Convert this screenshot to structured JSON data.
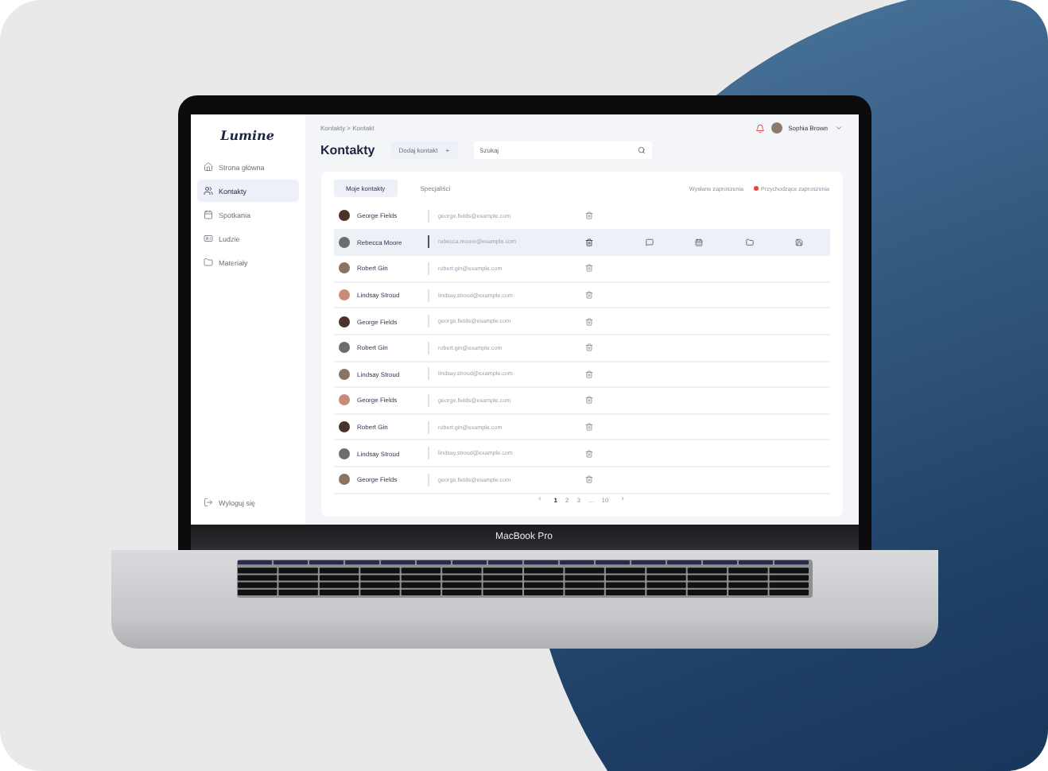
{
  "laptop": {
    "model_label": "MacBook Pro"
  },
  "app": {
    "logo": "Lumine",
    "nav": [
      {
        "kind": "home",
        "label": "Strona główna",
        "selected": false
      },
      {
        "kind": "users",
        "label": "Kontakty",
        "selected": true
      },
      {
        "kind": "calendar",
        "label": "Spotkania",
        "selected": false
      },
      {
        "kind": "card",
        "label": "Ludzie",
        "selected": false
      },
      {
        "kind": "folder",
        "label": "Materiały",
        "selected": false
      }
    ],
    "logout": "Wyloguj się",
    "breadcrumb": "Kontakty > Kontakt",
    "title": "Kontakty",
    "add_button": {
      "label": "Dodaj kontakt",
      "icon": "+"
    },
    "search": {
      "placeholder": "Szukaj"
    },
    "user": {
      "name": "Sophia Brown"
    },
    "tabs": [
      {
        "label": "Moje kontakty",
        "selected": true
      },
      {
        "label": "Specjaliści",
        "selected": false
      }
    ],
    "invites": [
      {
        "label": "Wysłane zaproszenia",
        "unread": false
      },
      {
        "label": "Przychodzące zaproszenia",
        "unread": true
      }
    ],
    "contacts": [
      {
        "name": "George Fields",
        "email": "george.fields@example.com",
        "selected": false
      },
      {
        "name": "Rebecca Moore",
        "email": "rebecca.moore@example.com",
        "selected": true
      },
      {
        "name": "Robert Gin",
        "email": "robert.gin@example.com",
        "selected": false
      },
      {
        "name": "Lindsay Stroud",
        "email": "lindsay.stroud@example.com",
        "selected": false
      },
      {
        "name": "George Fields",
        "email": "george.fields@example.com",
        "selected": false
      },
      {
        "name": "Robert Gin",
        "email": "robert.gin@example.com",
        "selected": false
      },
      {
        "name": "Lindsay Stroud",
        "email": "lindsay.stroud@example.com",
        "selected": false
      },
      {
        "name": "George Fields",
        "email": "george.fields@example.com",
        "selected": false
      },
      {
        "name": "Robert Gin",
        "email": "robert.gin@example.com",
        "selected": false
      },
      {
        "name": "Lindsay Stroud",
        "email": "lindsay.stroud@example.com",
        "selected": false
      },
      {
        "name": "George Fields",
        "email": "george.fields@example.com",
        "selected": false
      }
    ],
    "pagination": {
      "prev": "‹",
      "pages": [
        {
          "label": "1",
          "selected": true
        },
        {
          "label": "2",
          "selected": false
        },
        {
          "label": "3",
          "selected": false
        },
        {
          "label": "...",
          "selected": false
        },
        {
          "label": "10",
          "selected": false
        }
      ],
      "next": "›"
    }
  }
}
